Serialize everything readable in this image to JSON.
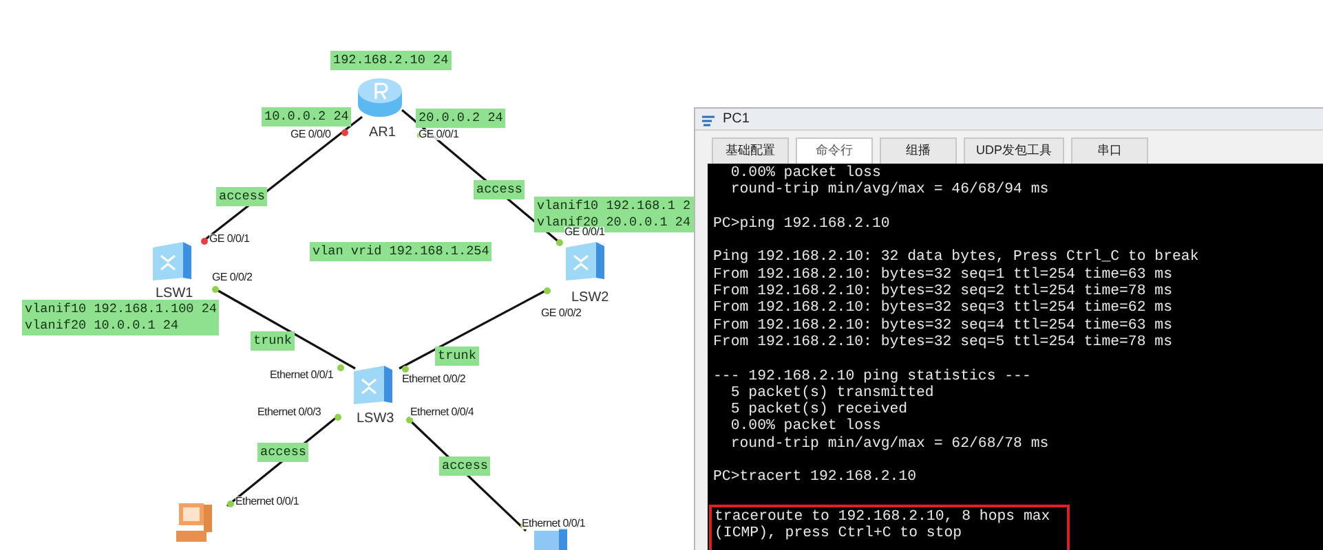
{
  "topology": {
    "devices": [
      {
        "name": "AR1",
        "kind": "router"
      },
      {
        "name": "LSW1",
        "kind": "switch"
      },
      {
        "name": "LSW2",
        "kind": "switch"
      },
      {
        "name": "LSW3",
        "kind": "switch"
      },
      {
        "kind": "pc"
      },
      {
        "kind": "pc2"
      }
    ],
    "ports": [
      {
        "label": "GE 0/0/0",
        "color": "#e84040"
      },
      {
        "label": "GE 0/0/1",
        "color": "#8fd14f"
      },
      {
        "label": "GE 0/0/1",
        "color": "#e84040"
      },
      {
        "label": "GE 0/0/2",
        "color": "#8fd14f"
      },
      {
        "label": "GE 0/0/1",
        "color": "#8fd14f"
      },
      {
        "label": "GE 0/0/2",
        "color": "#8fd14f"
      },
      {
        "label": "Ethernet 0/0/1",
        "color": "#8fd14f"
      },
      {
        "label": "Ethernet 0/0/2",
        "color": "#8fd14f"
      },
      {
        "label": "Ethernet 0/0/3",
        "color": "#8fd14f"
      },
      {
        "label": "Ethernet 0/0/4",
        "color": "#8fd14f"
      },
      {
        "label": "Ethernet 0/0/1",
        "color": "#8fd14f"
      },
      {
        "label": "Ethernet 0/0/1",
        "color": "#8fd14f"
      }
    ],
    "notes": [
      {
        "lines": [
          "192.168.2.10 24"
        ]
      },
      {
        "lines": [
          "10.0.0.2 24"
        ]
      },
      {
        "lines": [
          "20.0.0.2 24"
        ]
      },
      {
        "lines": [
          "access"
        ]
      },
      {
        "lines": [
          "access"
        ]
      },
      {
        "lines": [
          "vlanif10 192.168.1 2",
          "vlanif20 20.0.0.1 24"
        ]
      },
      {
        "lines": [
          "vlan vrid 192.168.1.254"
        ]
      },
      {
        "lines": [
          "vlanif10 192.168.1.100 24",
          "vlanif20 10.0.0.1 24"
        ]
      },
      {
        "lines": [
          "trunk"
        ]
      },
      {
        "lines": [
          "trunk"
        ]
      },
      {
        "lines": [
          "access"
        ]
      },
      {
        "lines": [
          "access"
        ]
      }
    ]
  },
  "window": {
    "title": "PC1",
    "tabs": [
      {
        "label": "基础配置",
        "selected": false
      },
      {
        "label": "命令行",
        "selected": true
      },
      {
        "label": "组播",
        "selected": false
      },
      {
        "label": "UDP发包工具",
        "selected": false
      },
      {
        "label": "串口",
        "selected": false
      }
    ],
    "terminal_blocks": [
      [
        "  0.00% packet loss",
        "  round-trip min/avg/max = 46/68/94 ms"
      ],
      [
        "PC>ping 192.168.2.10"
      ],
      [
        "Ping 192.168.2.10: 32 data bytes, Press Ctrl_C to break",
        "From 192.168.2.10: bytes=32 seq=1 ttl=254 time=63 ms",
        "From 192.168.2.10: bytes=32 seq=2 ttl=254 time=78 ms",
        "From 192.168.2.10: bytes=32 seq=3 ttl=254 time=62 ms",
        "From 192.168.2.10: bytes=32 seq=4 ttl=254 time=63 ms",
        "From 192.168.2.10: bytes=32 seq=5 ttl=254 time=78 ms"
      ],
      [
        "--- 192.168.2.10 ping statistics ---",
        "  5 packet(s) transmitted",
        "  5 packet(s) received",
        "  0.00% packet loss",
        "  round-trip min/avg/max = 62/68/78 ms"
      ],
      [
        "PC>tracert 192.168.2.10"
      ]
    ],
    "highlighted_lines": [
      "traceroute to 192.168.2.10, 8 hops max",
      "(ICMP), press Ctrl+C to stop"
    ]
  }
}
